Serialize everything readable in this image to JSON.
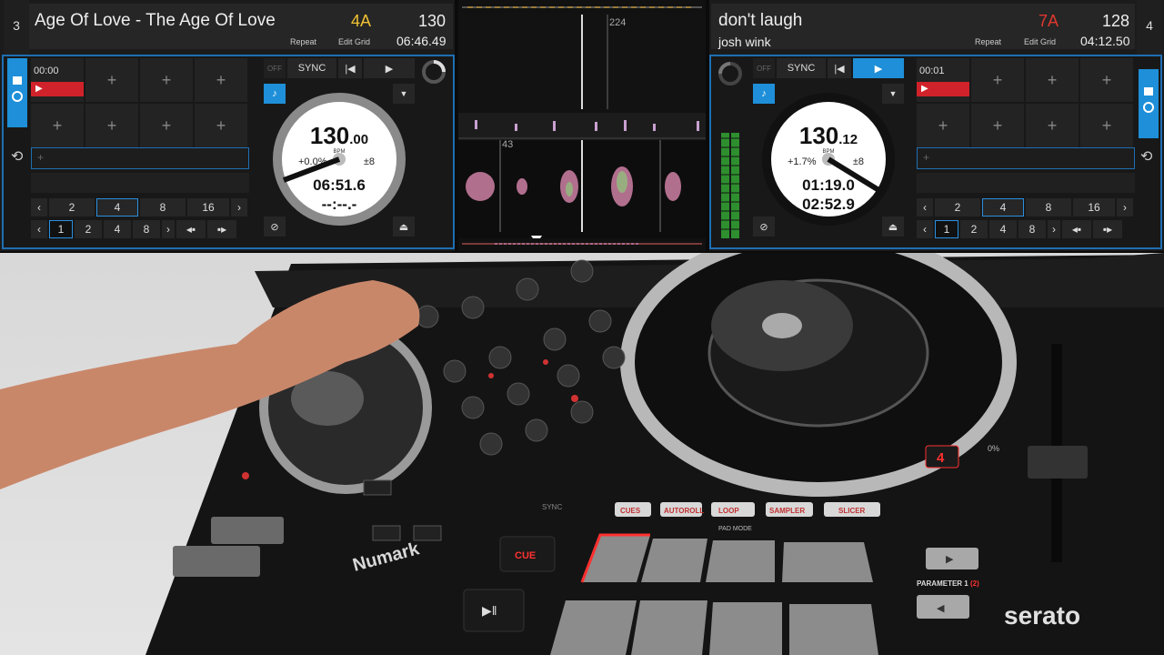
{
  "deck_left": {
    "number": "3",
    "title": "Age Of Love - The Age Of Love",
    "key": "4A",
    "bpm": "130",
    "repeat": "Repeat",
    "edit_grid": "Edit Grid",
    "time_remaining": "06:46.49",
    "sync": "SYNC",
    "off": "OFF",
    "platter": {
      "bpm": "130",
      "bpm_dec": ".00",
      "bpm_label": "BPM",
      "pitch": "+0.0%",
      "range": "±8",
      "time1": "06:51.6",
      "time2": "--:--.-"
    },
    "first_cue_time": "00:00",
    "loop_sizes": [
      "2",
      "4",
      "8",
      "16"
    ],
    "beatjump_sizes": [
      "1",
      "2",
      "4",
      "8"
    ]
  },
  "deck_right": {
    "number": "4",
    "title": "don't laugh",
    "artist": "josh wink",
    "key": "7A",
    "bpm": "128",
    "repeat": "Repeat",
    "edit_grid": "Edit Grid",
    "time_remaining": "04:12.50",
    "sync": "SYNC",
    "off": "OFF",
    "platter": {
      "bpm": "130",
      "bpm_dec": ".12",
      "bpm_label": "BPM",
      "pitch": "+1.7%",
      "range": "±8",
      "time1": "01:19.0",
      "time2": "02:52.9"
    },
    "first_cue_time": "00:01",
    "loop_sizes": [
      "2",
      "4",
      "8",
      "16"
    ],
    "beatjump_sizes": [
      "1",
      "2",
      "4",
      "8"
    ]
  },
  "waveform": {
    "bar_top": "224",
    "bar_bottom": "43"
  },
  "hardware": {
    "brand": "Numark",
    "software": "serato",
    "cue_label": "CUE",
    "pad_modes": [
      "CUES",
      "AUTOROLL",
      "LOOP",
      "SAMPLER",
      "SLICER"
    ],
    "pad_mode_caption": "PAD MODE",
    "parameter": "PARAMETER 1",
    "parameter_2": "(2)",
    "deck_indicator": "4",
    "pitch_zero": "0%",
    "sync_label": "SYNC"
  },
  "colors": {
    "accent": "#1e8fd8",
    "cue_red": "#d0222a",
    "key_left": "#f1c232",
    "key_right": "#e0382f"
  }
}
